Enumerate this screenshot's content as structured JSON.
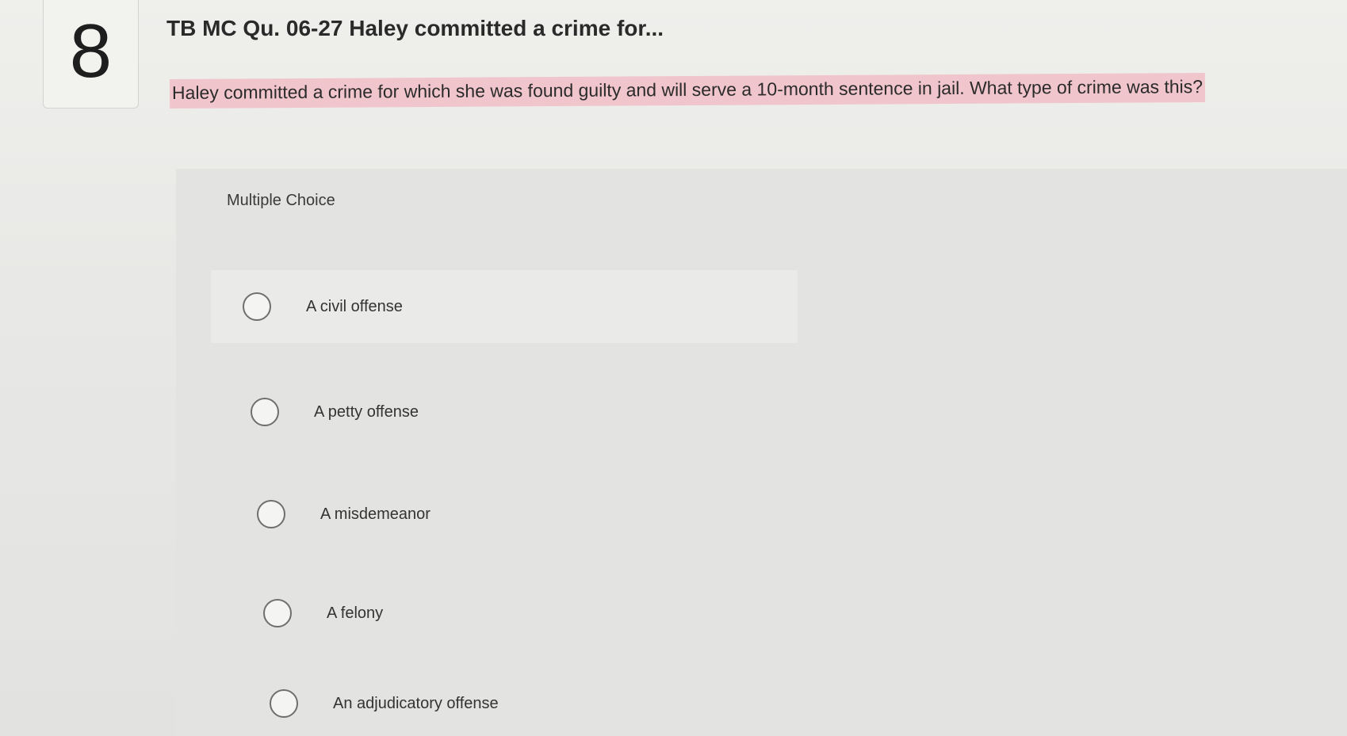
{
  "question": {
    "number": "8",
    "title": "TB MC Qu. 06-27 Haley committed a crime for...",
    "text": "Haley committed a crime for which she was found guilty and will serve a 10-month sentence in jail. What type of crime was this?",
    "highlight_color": "#f0c6cc"
  },
  "answer_area": {
    "type_label": "Multiple Choice",
    "options": [
      {
        "label": "A civil offense",
        "selected": false
      },
      {
        "label": "A petty offense",
        "selected": false
      },
      {
        "label": "A misdemeanor",
        "selected": false
      },
      {
        "label": "A felony",
        "selected": false
      },
      {
        "label": "An adjudicatory offense",
        "selected": false
      }
    ]
  }
}
